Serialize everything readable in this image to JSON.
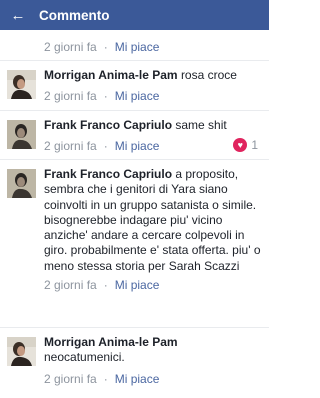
{
  "header": {
    "title": "Commento",
    "back_icon": "arrow-left-icon"
  },
  "top_meta": {
    "time": "2 giorni fa",
    "like_label": "Mi piace"
  },
  "comments": [
    {
      "author": "Morrigan Anima-le Pam",
      "text": "rosa croce",
      "time": "2 giorni fa",
      "like_label": "Mi piace"
    },
    {
      "author": "Frank Franco Capriulo",
      "text": "same shit",
      "time": "2 giorni fa",
      "like_label": "Mi piace",
      "reaction_icon": "heart-icon",
      "reaction_count": "1"
    },
    {
      "author": "Frank Franco Capriulo",
      "text": "a proposito, sembra che i genitori di Yara siano coinvolti in un gruppo satanista o simile. bisognerebbe indagare piu' vicino anziche' andare a cercare colpevoli in giro. probabilmente e' stata offerta. piu' o meno stessa storia per Sarah Scazzi",
      "time": "2 giorni fa",
      "like_label": "Mi piace"
    },
    {
      "author": "Morrigan Anima-le Pam",
      "text": "neocatumenici.",
      "time": "2 giorni fa",
      "like_label": "Mi piace"
    }
  ],
  "colors": {
    "header_bg": "#3b5998",
    "link": "#4b67a1",
    "muted": "#8d949e",
    "heart": "#e0245e"
  }
}
